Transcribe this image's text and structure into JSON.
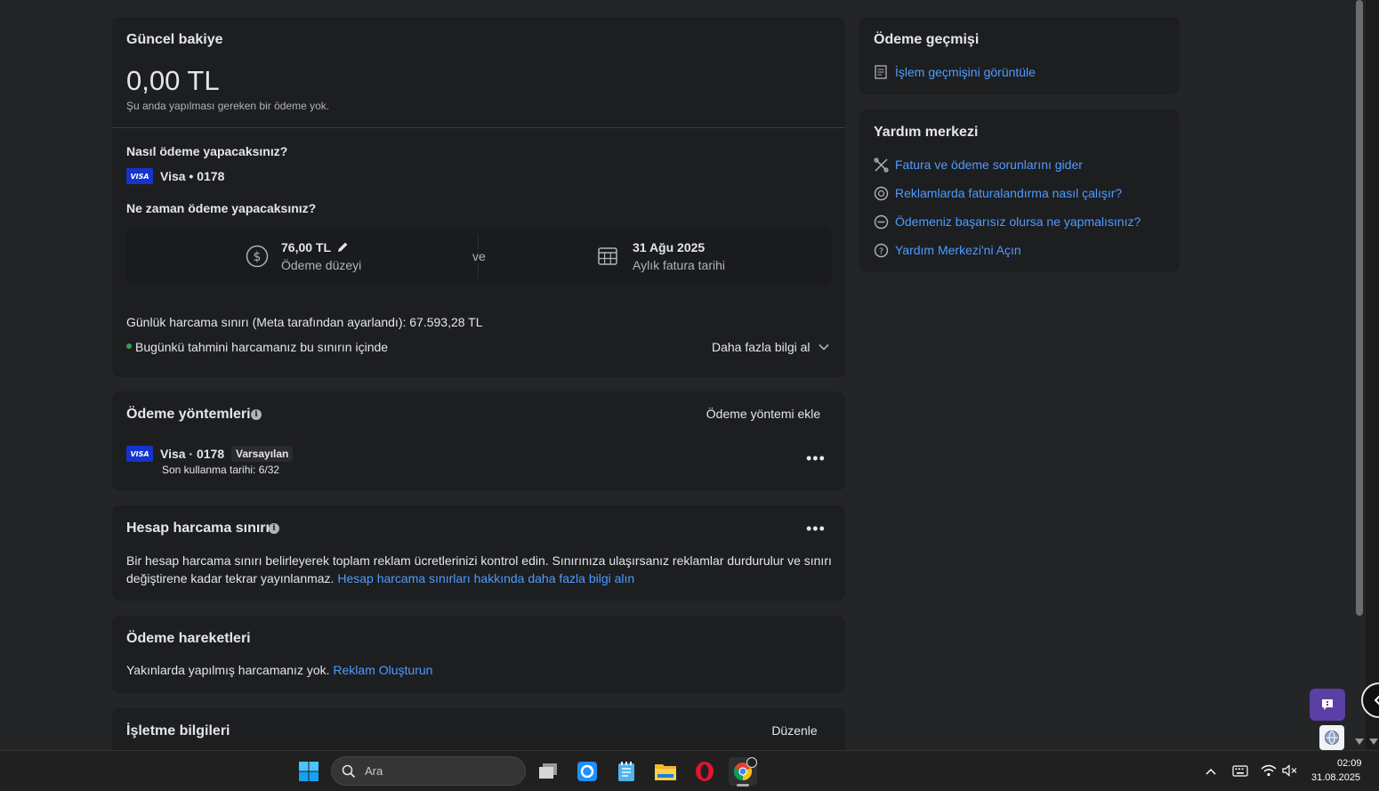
{
  "balance": {
    "title": "Güncel bakiye",
    "amount": "0,00 TL",
    "note": "Şu anda yapılması gereken bir ödeme yok."
  },
  "how": {
    "title": "Nasıl ödeme yapacaksınız?",
    "card_brand": "VISA",
    "card": "Visa • 0178"
  },
  "when": {
    "title": "Ne zaman ödeme yapacaksınız?",
    "threshold_amount": "76,00 TL",
    "threshold_label": "Ödeme düzeyi",
    "and": "ve",
    "date": "31 Ağu 2025",
    "date_label": "Aylık fatura tarihi"
  },
  "daily": {
    "limit_text": "Günlük harcama sınırı (Meta tarafından ayarlandı): 67.593,28 TL",
    "status": "Bugünkü tahmini harcamanız bu sınırın içinde",
    "more": "Daha fazla bilgi al"
  },
  "methods": {
    "title": "Ödeme yöntemleri",
    "add": "Ödeme yöntemi ekle",
    "card_brand": "VISA",
    "card": "Visa · 0178",
    "default_badge": "Varsayılan",
    "expiry": "Son kullanma tarihi: 6/32"
  },
  "spend_limit": {
    "title": "Hesap harcama sınırı",
    "line1": "Bir hesap harcama sınırı belirleyerek toplam reklam ücretlerinizi kontrol edin. Sınırınıza ulaşırsanız reklamlar durdurulur ve sınırı",
    "line2": "değiştirene kadar tekrar yayınlanmaz.",
    "link": "Hesap harcama sınırları hakkında daha fazla bilgi alın"
  },
  "activity": {
    "title": "Ödeme hareketleri",
    "text": "Yakınlarda yapılmış harcamanız yok.",
    "link": "Reklam Oluşturun"
  },
  "business": {
    "title": "İşletme bilgileri",
    "edit": "Düzenle"
  },
  "history": {
    "title": "Ödeme geçmişi",
    "link": "İşlem geçmişini görüntüle"
  },
  "help": {
    "title": "Yardım merkezi",
    "links": [
      "Fatura ve ödeme sorunlarını gider",
      "Reklamlarda faturalandırma nasıl çalışır?",
      "Ödemeniz başarısız olursa ne yapmalısınız?",
      "Yardım Merkezi'ni Açın"
    ]
  },
  "taskbar": {
    "search_placeholder": "Ara",
    "time": "02:09",
    "date": "31.08.2025"
  },
  "colors": {
    "link": "#4e9cff",
    "status_dot": "#31a24c",
    "visa": "#1434cb",
    "chat": "#5b3fa6"
  }
}
